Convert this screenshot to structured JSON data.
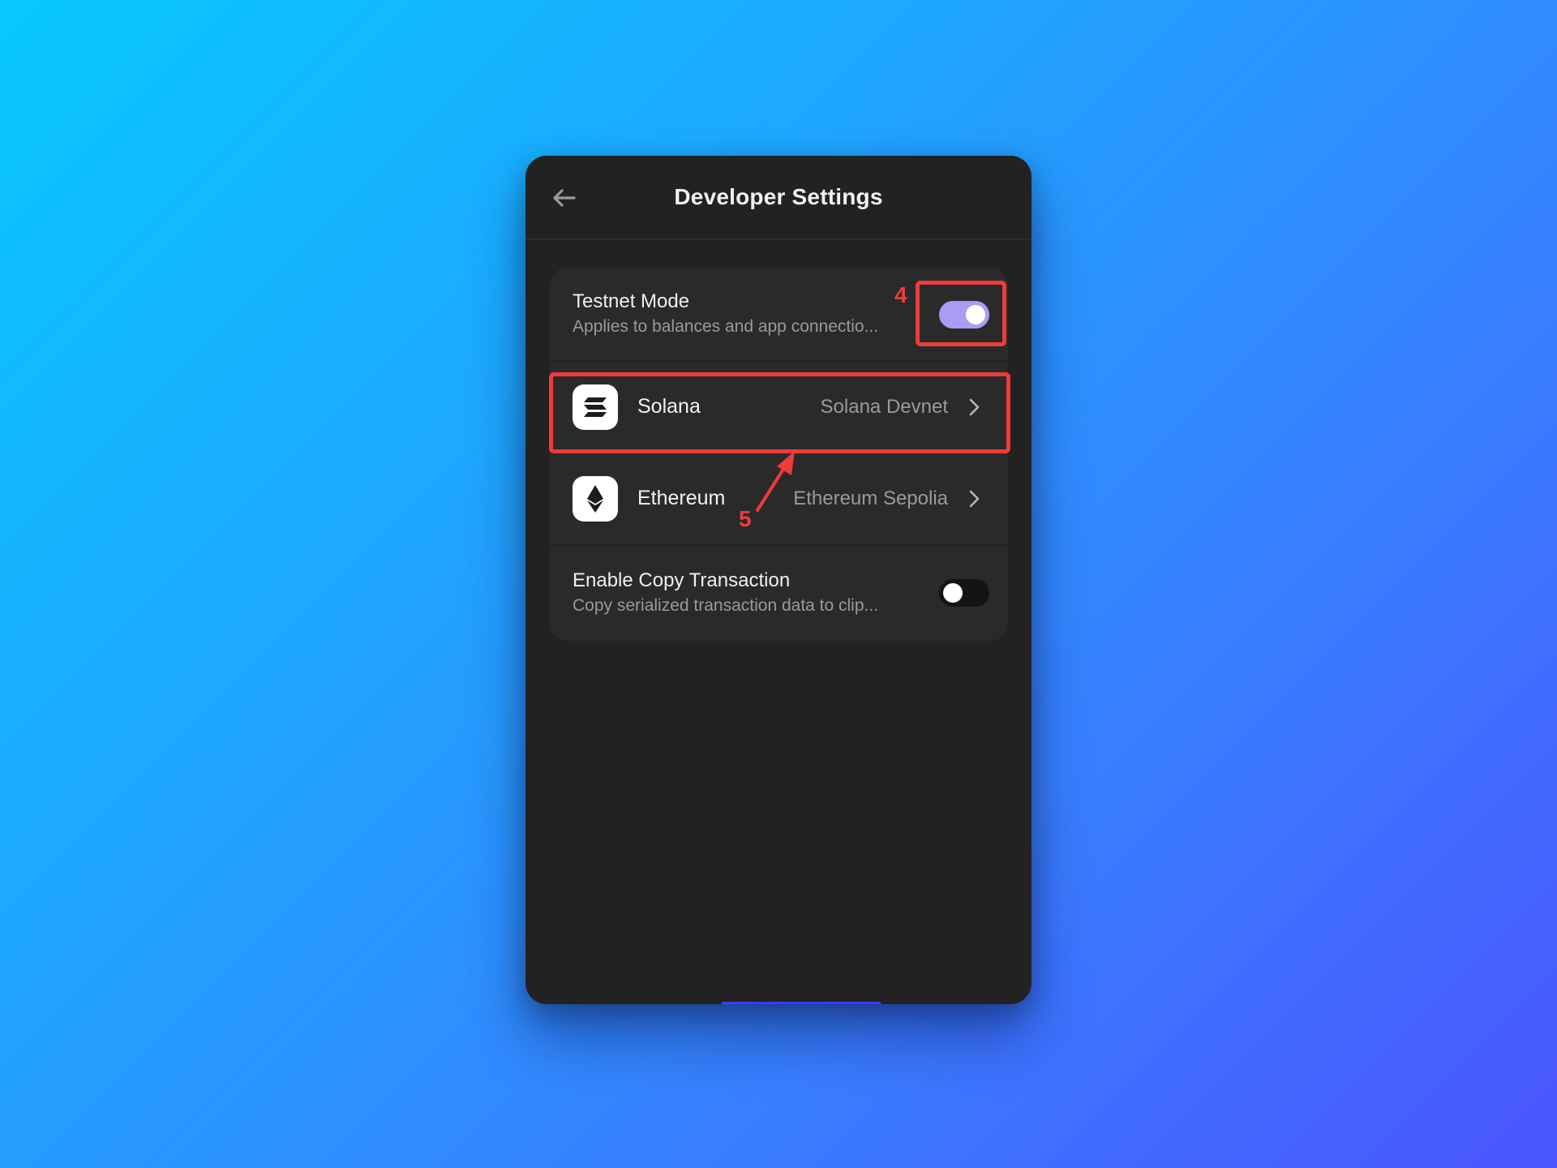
{
  "header": {
    "title": "Developer Settings",
    "back_icon": "arrow-left-icon"
  },
  "testnet": {
    "title": "Testnet Mode",
    "subtitle": "Applies to balances and app connectio...",
    "enabled": true
  },
  "networks": [
    {
      "name": "Solana",
      "value": "Solana Devnet",
      "icon": "solana-logo-icon"
    },
    {
      "name": "Ethereum",
      "value": "Ethereum Sepolia",
      "icon": "ethereum-logo-icon"
    }
  ],
  "copy_tx": {
    "title": "Enable Copy Transaction",
    "subtitle": "Copy serialized transaction data to clip...",
    "enabled": false
  },
  "annotations": {
    "step_toggle": "4",
    "step_solana": "5"
  },
  "colors": {
    "highlight": "#ee3b3b",
    "toggle_on": "#a99cf3",
    "panel": "#222222",
    "card": "#2a2a2a"
  }
}
